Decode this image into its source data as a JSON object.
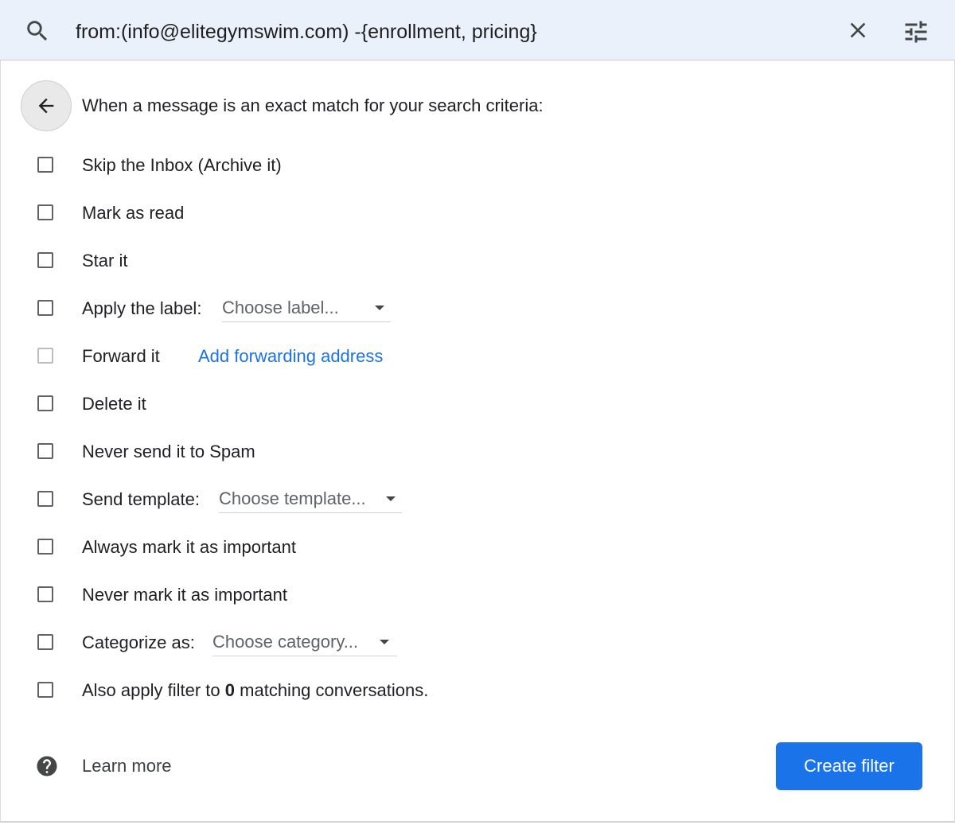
{
  "search": {
    "query": "from:(info@elitegymswim.com) -{enrollment, pricing}",
    "search_icon": "search-icon",
    "clear_icon": "close-icon",
    "options_icon": "tune-icon"
  },
  "filter_panel": {
    "back_icon": "arrow-back-icon",
    "header": "When a message is an exact match for your search criteria:",
    "options": [
      {
        "label": "Skip the Inbox (Archive it)",
        "checked": false
      },
      {
        "label": "Mark as read",
        "checked": false
      },
      {
        "label": "Star it",
        "checked": false
      },
      {
        "label": "Apply the label:",
        "checked": false,
        "dropdown": "Choose label..."
      },
      {
        "label": "Forward it",
        "checked": false,
        "disabled": true,
        "link": "Add forwarding address"
      },
      {
        "label": "Delete it",
        "checked": false
      },
      {
        "label": "Never send it to Spam",
        "checked": false
      },
      {
        "label": "Send template:",
        "checked": false,
        "dropdown": "Choose template..."
      },
      {
        "label": "Always mark it as important",
        "checked": false
      },
      {
        "label": "Never mark it as important",
        "checked": false
      },
      {
        "label": "Categorize as:",
        "checked": false,
        "dropdown": "Choose category..."
      },
      {
        "label_prefix": "Also apply filter to",
        "count": "0",
        "label_suffix": "matching conversations.",
        "checked": false
      }
    ]
  },
  "footer": {
    "help_icon": "help-icon",
    "learn_more": "Learn more",
    "create_filter": "Create filter"
  },
  "colors": {
    "search_bar_bg": "#eaf1fb",
    "primary_blue": "#1a73e8",
    "text": "#202124",
    "secondary_text": "#5f6368"
  }
}
